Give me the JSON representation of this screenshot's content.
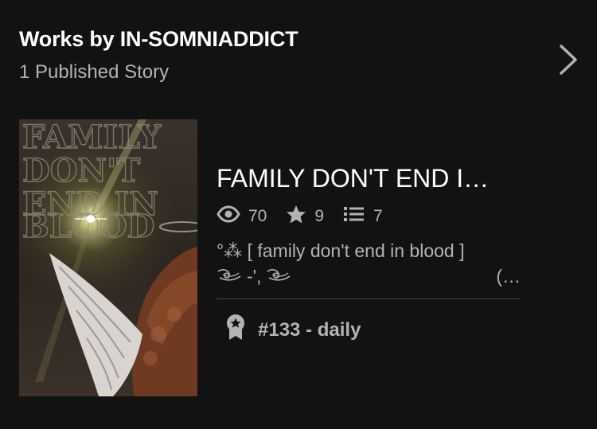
{
  "header": {
    "title": "Works by IN-SOMNIADDICT",
    "subtitle": "1 Published Story",
    "chevron_icon": "chevron-right-icon"
  },
  "story": {
    "cover_text": [
      "FAMILY",
      "DON'T",
      "END IN",
      "BLOOD"
    ],
    "title": "FAMILY DON'T END I…",
    "stats": {
      "reads": "70",
      "votes": "9",
      "parts": "7"
    },
    "description_line1": "°⁂ [ family don't end in blood ]",
    "description_dash": "-',",
    "description_more": "(…",
    "rank": "#133 - daily",
    "icons": {
      "reads": "eye-icon",
      "votes": "star-icon",
      "parts": "list-icon",
      "swirl": "swirl-icon",
      "rank": "award-ribbon-icon"
    }
  },
  "colors": {
    "background": "#121212",
    "text_primary": "#ffffff",
    "text_secondary": "#b3b3b3",
    "divider": "#4a4a4a"
  }
}
